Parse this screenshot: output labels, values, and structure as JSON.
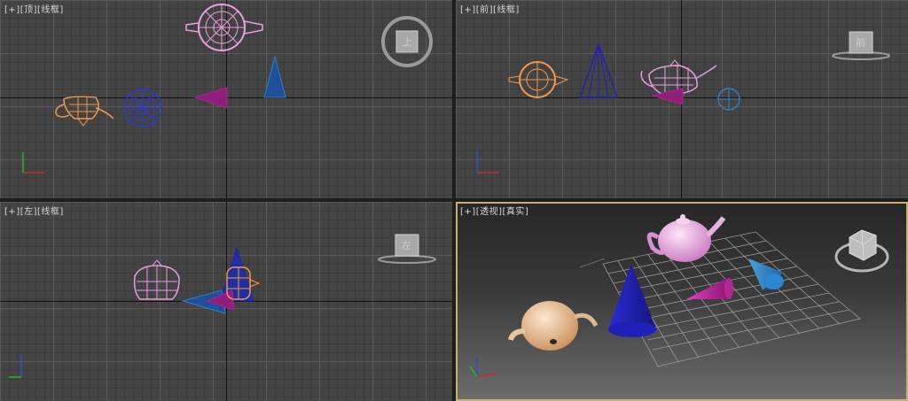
{
  "viewports": {
    "top": {
      "plus": "[+]",
      "view": "[顶]",
      "shading": "[线框]",
      "cube_label": "上"
    },
    "front": {
      "plus": "[+]",
      "view": "[前]",
      "shading": "[线框]",
      "cube_label": "前"
    },
    "left": {
      "plus": "[+]",
      "view": "[左]",
      "shading": "[线框]",
      "cube_label": "左"
    },
    "perspective": {
      "plus": "[+]",
      "view": "[透视]",
      "shading": "[真实]"
    }
  },
  "axes": {
    "x": "x",
    "y": "y",
    "z": "z"
  },
  "colors": {
    "teapot_pink": "#e79ee0",
    "teapot_orange": "#f19a4a",
    "cone_blue": "#2222b0",
    "cone_magenta": "#b0208e",
    "sphere_blue": "#2a3ad0",
    "cone_cyan": "#2f7fc0",
    "active_border": "#c8b070"
  }
}
